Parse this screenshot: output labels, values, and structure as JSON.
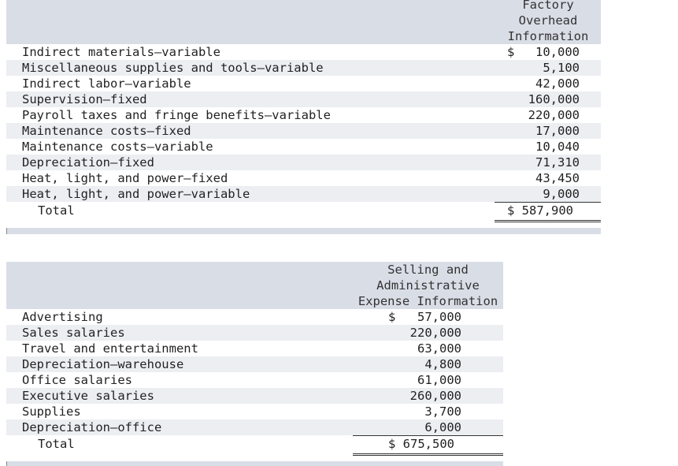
{
  "factory": {
    "header": [
      "Factory",
      "Overhead",
      "Information"
    ],
    "currency": "$",
    "rows": [
      {
        "label": "Indirect materials—variable",
        "value": "10,000"
      },
      {
        "label": "Miscellaneous supplies and tools—variable",
        "value": "5,100"
      },
      {
        "label": "Indirect labor—variable",
        "value": "42,000"
      },
      {
        "label": "Supervision—fixed",
        "value": "160,000"
      },
      {
        "label": "Payroll taxes and fringe benefits—variable",
        "value": "220,000"
      },
      {
        "label": "Maintenance costs—fixed",
        "value": "17,000"
      },
      {
        "label": "Maintenance costs—variable",
        "value": "10,040"
      },
      {
        "label": "Depreciation—fixed",
        "value": "71,310"
      },
      {
        "label": "Heat, light, and power—fixed",
        "value": "43,450"
      },
      {
        "label": "Heat, light, and power—variable",
        "value": "9,000"
      }
    ],
    "total_label": "Total",
    "total_value": "$ 587,900"
  },
  "selling": {
    "header": [
      "Selling and",
      "Administrative",
      "Expense Information"
    ],
    "currency": "$",
    "rows": [
      {
        "label": "Advertising",
        "value": "57,000"
      },
      {
        "label": "Sales salaries",
        "value": "220,000"
      },
      {
        "label": "Travel and entertainment",
        "value": "63,000"
      },
      {
        "label": "Depreciation—warehouse",
        "value": "4,800"
      },
      {
        "label": "Office salaries",
        "value": "61,000"
      },
      {
        "label": "Executive salaries",
        "value": "260,000"
      },
      {
        "label": "Supplies",
        "value": "3,700"
      },
      {
        "label": "Depreciation—office",
        "value": "6,000"
      }
    ],
    "total_label": "Total",
    "total_value": "$ 675,500"
  }
}
